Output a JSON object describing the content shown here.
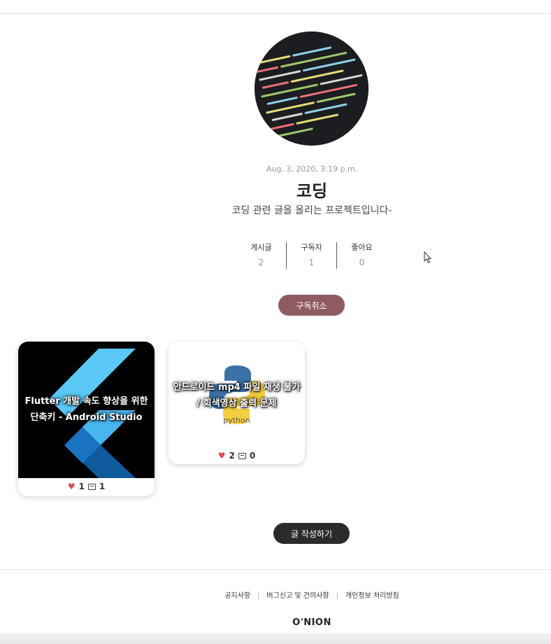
{
  "project": {
    "date": "Aug. 3, 2020, 3:19 p.m.",
    "title": "코딩",
    "description": "코딩 관련 글을 올리는 프로젝트입니다-"
  },
  "stats": [
    {
      "label": "게시글",
      "value": "2"
    },
    {
      "label": "구독자",
      "value": "1"
    },
    {
      "label": "좋아요",
      "value": "0"
    }
  ],
  "buttons": {
    "unsubscribe": "구독취소",
    "write": "글 작성하기"
  },
  "posts": [
    {
      "title": "Flutter 개발 속도 향상을 위한 단축키 - Android Studio",
      "likes": "1",
      "comments": "1",
      "thumbnail": "flutter-logo"
    },
    {
      "title": "안드로이드 mp4 파일 재생 불가 / 회색영상 출력 문제",
      "likes": "2",
      "comments": "0",
      "thumbnail": "python-logo",
      "logo_text": "python"
    }
  ],
  "footer": {
    "links": [
      "공지사항",
      "버그신고 및 건의사항",
      "개인정보 처리방침"
    ],
    "brand": "O'NION"
  },
  "colors": {
    "unsubscribe_button": "#8f5b63",
    "write_button": "#2b2b2b",
    "heart": "#e0495b"
  }
}
